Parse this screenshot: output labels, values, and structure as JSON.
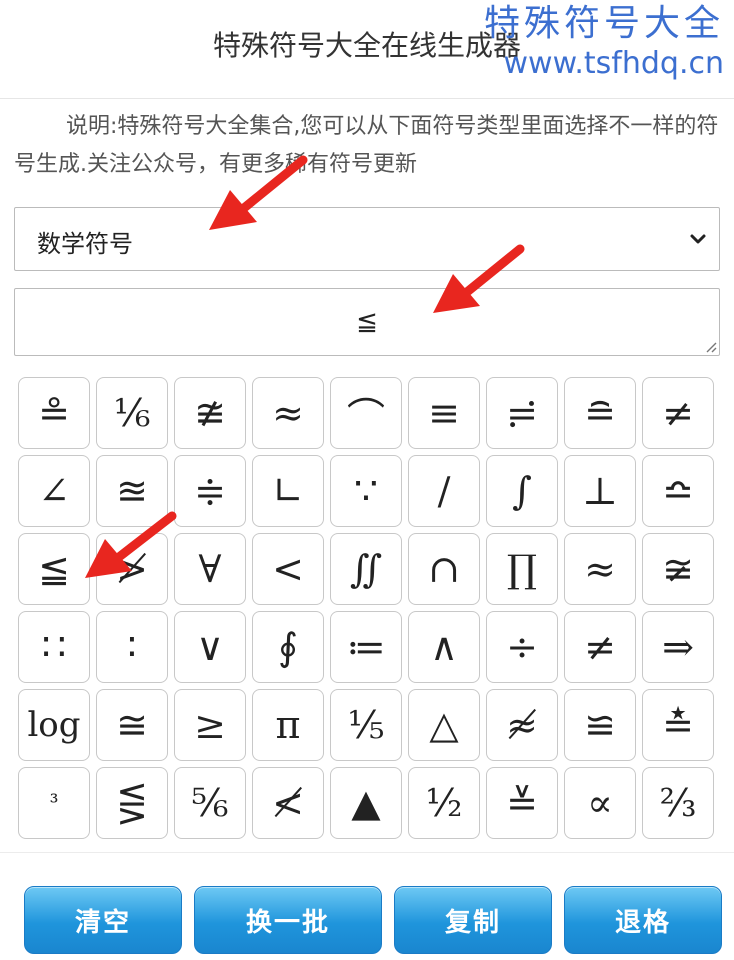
{
  "header": {
    "title": "特殊符号大全在线生成器"
  },
  "watermark": {
    "name": "特殊符号大全",
    "url": "www.tsfhdq.cn"
  },
  "description": "说明:特殊符号大全集合,您可以从下面符号类型里面选择不一样的符号生成.关注公众号，有更多稀有符号更新",
  "category_select": {
    "selected": "数学符号"
  },
  "output": {
    "value": "≦"
  },
  "symbols": [
    "≗",
    "⅙",
    "≇",
    "≈",
    "⌒",
    "≡",
    "≓",
    "≘",
    "≠",
    "∠",
    "≊",
    "≑",
    "∟",
    "∵",
    "∕",
    "∫",
    "⊥",
    "≏",
    "≦",
    "≯",
    "∀",
    "<",
    "∬",
    "∩",
    "∏",
    "≈",
    "≆",
    "∷",
    "∶",
    "∨",
    "∮",
    "≔",
    "∧",
    "÷",
    "≠",
    "⇒",
    "log",
    "≅",
    "≥",
    "π",
    "⅕",
    "△",
    "≉",
    "≌",
    "≛",
    "³",
    "⋚",
    "⅚",
    "≮",
    "▲",
    "½",
    "≚",
    "∝",
    "⅔"
  ],
  "buttons": {
    "clear": "清空",
    "next_batch": "换一批",
    "copy": "复制",
    "backspace": "退格"
  },
  "colors": {
    "watermark": "#3c6fd0",
    "button_top": "#6ec9f4",
    "button_bottom": "#1a86cf",
    "arrow": "#e8261f"
  }
}
